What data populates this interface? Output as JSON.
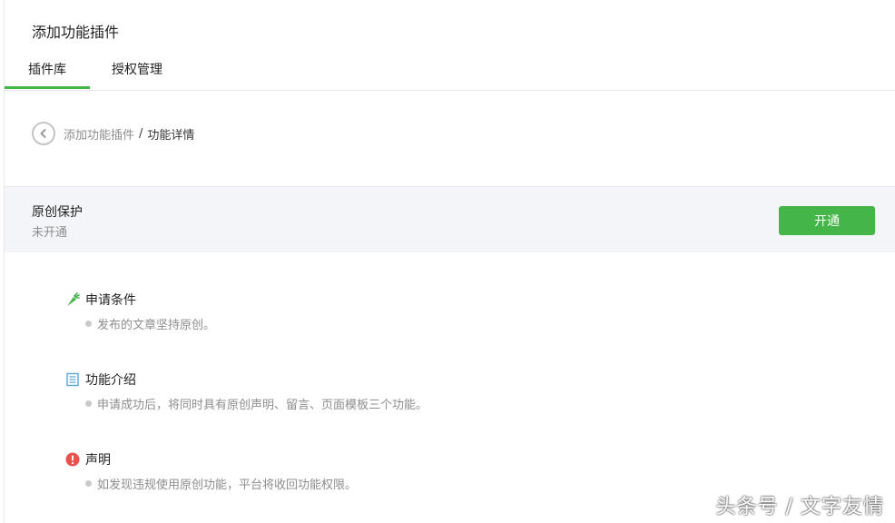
{
  "page": {
    "title": "添加功能插件"
  },
  "tabs": [
    {
      "label": "插件库",
      "active": true
    },
    {
      "label": "授权管理",
      "active": false
    }
  ],
  "breadcrumb": {
    "parent": "添加功能插件",
    "separator": "/",
    "current": "功能详情"
  },
  "plugin": {
    "name": "原创保护",
    "status": "未开通",
    "action_label": "开通"
  },
  "sections": [
    {
      "title": "申请条件",
      "icon": "carrot-icon",
      "items": [
        "发布的文章坚持原创。"
      ]
    },
    {
      "title": "功能介绍",
      "icon": "document-icon",
      "items": [
        "申请成功后，将同时具有原创声明、留言、页面模板三个功能。"
      ]
    },
    {
      "title": "声明",
      "icon": "warning-icon",
      "items": [
        "如发现违规使用原创功能，平台将收回功能权限。"
      ]
    }
  ],
  "watermark": "头条号 / 文字友情",
  "colors": {
    "accent": "#44b549",
    "warning": "#e9524c",
    "doc": "#5ba6d8"
  }
}
